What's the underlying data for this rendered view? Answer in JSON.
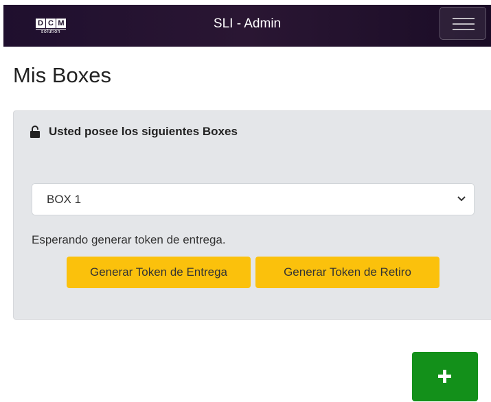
{
  "navbar": {
    "logo": {
      "letters": [
        "D",
        "C",
        "M"
      ],
      "subtext": "solution"
    },
    "title": "SLI - Admin",
    "menu_icon": "hamburger-icon"
  },
  "page": {
    "title": "Mis Boxes"
  },
  "card": {
    "header_icon": "lock-icon",
    "header_title": "Usted posee los siguientes Boxes",
    "select": {
      "selected": "BOX 1",
      "icon": "chevron-down-icon"
    },
    "status_text": "Esperando generar token de entrega.",
    "buttons": {
      "entrega_label": "Generar Token de Entrega",
      "retiro_label": "Generar Token de Retiro"
    }
  },
  "fab": {
    "icon": "plus-icon"
  },
  "colors": {
    "navbar_bg": "#1f0f2e",
    "card_bg": "#e4e6e9",
    "button_yellow": "#fbc10c",
    "fab_green": "#13901a"
  }
}
